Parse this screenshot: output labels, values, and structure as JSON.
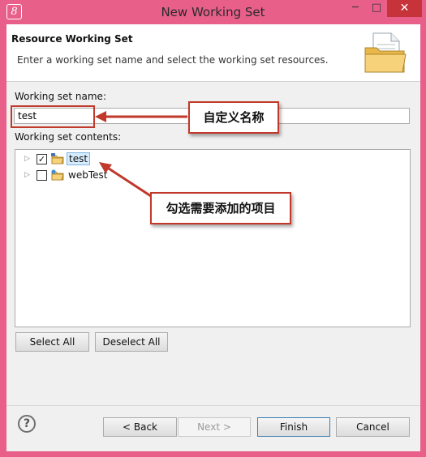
{
  "titlebar": {
    "app_icon_glyph": "8",
    "title": "New Working Set",
    "minimize_glyph": "─",
    "maximize_glyph": "□",
    "close_glyph": "✕"
  },
  "banner": {
    "title": "Resource Working Set",
    "description": "Enter a working set name and select the working set resources.",
    "icon": "folder-document-icon"
  },
  "form": {
    "name_label": "Working set name:",
    "name_value": "test",
    "contents_label": "Working set contents:"
  },
  "tree": {
    "items": [
      {
        "label": "test",
        "checked": true,
        "selected": true,
        "check_glyph": "✓",
        "expander_glyph": "▷"
      },
      {
        "label": "webTest",
        "checked": false,
        "selected": false,
        "check_glyph": "",
        "expander_glyph": "▷"
      }
    ]
  },
  "selection_buttons": {
    "select_all": "Select All",
    "deselect_all": "Deselect All"
  },
  "footer": {
    "help_glyph": "?",
    "back": "< Back",
    "next": "Next >",
    "finish": "Finish",
    "cancel": "Cancel"
  },
  "annotations": {
    "name_callout": "自定义名称",
    "select_callout": "勾选需要添加的项目"
  },
  "colors": {
    "window_frame": "#e8608a",
    "close_button": "#c7333b",
    "annotation_red": "#c0392b",
    "selection_bg": "#d6ebfb"
  }
}
